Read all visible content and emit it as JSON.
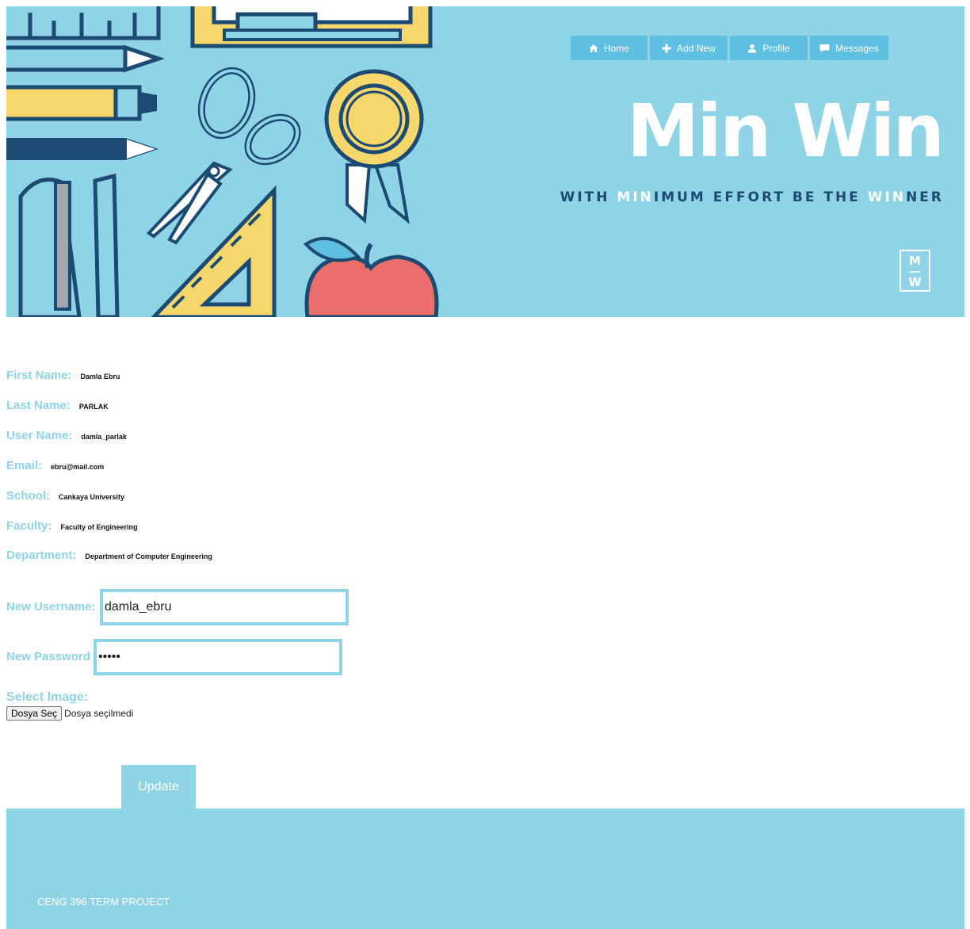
{
  "nav": {
    "items": [
      {
        "label": "Home",
        "icon": "home-icon"
      },
      {
        "label": "Add New",
        "icon": "plus-icon"
      },
      {
        "label": "Profile",
        "icon": "user-icon"
      },
      {
        "label": "Messages",
        "icon": "chat-icon"
      }
    ]
  },
  "brand": {
    "title": "Min Win",
    "tagline": {
      "w1": "WITH ",
      "w2": "MIN",
      "w3": "IMUM EFFORT BE THE ",
      "w4": "WIN",
      "w5": "NER"
    },
    "logo": {
      "top": "M",
      "bottom": "W"
    }
  },
  "profile": {
    "rows": [
      {
        "label": "First Name:",
        "value": "Damla Ebru"
      },
      {
        "label": "Last Name:",
        "value": "PARLAK"
      },
      {
        "label": "User Name:",
        "value": "damla_parlak"
      },
      {
        "label": "Email:",
        "value": "ebru@mail.com"
      },
      {
        "label": "School:",
        "value": "Cankaya University"
      },
      {
        "label": "Faculty:",
        "value": "Faculty of Engineering"
      },
      {
        "label": "Department:",
        "value": "Department of Computer Engineering"
      }
    ]
  },
  "form": {
    "username_label": "New Username:",
    "username_value": "damla_ebru",
    "password_label": "New Password",
    "password_value": "•••••",
    "image_label": "Select Image:",
    "file_button": "Dosya Seç",
    "file_status": "Dosya seçilmedi",
    "update_label": "Update"
  },
  "footer": {
    "text": "CENG 396 TERM PROJECT"
  },
  "colors": {
    "accent": "#8fd3e6",
    "nav_button": "#5fbfe0",
    "navy": "#1b4a73"
  }
}
